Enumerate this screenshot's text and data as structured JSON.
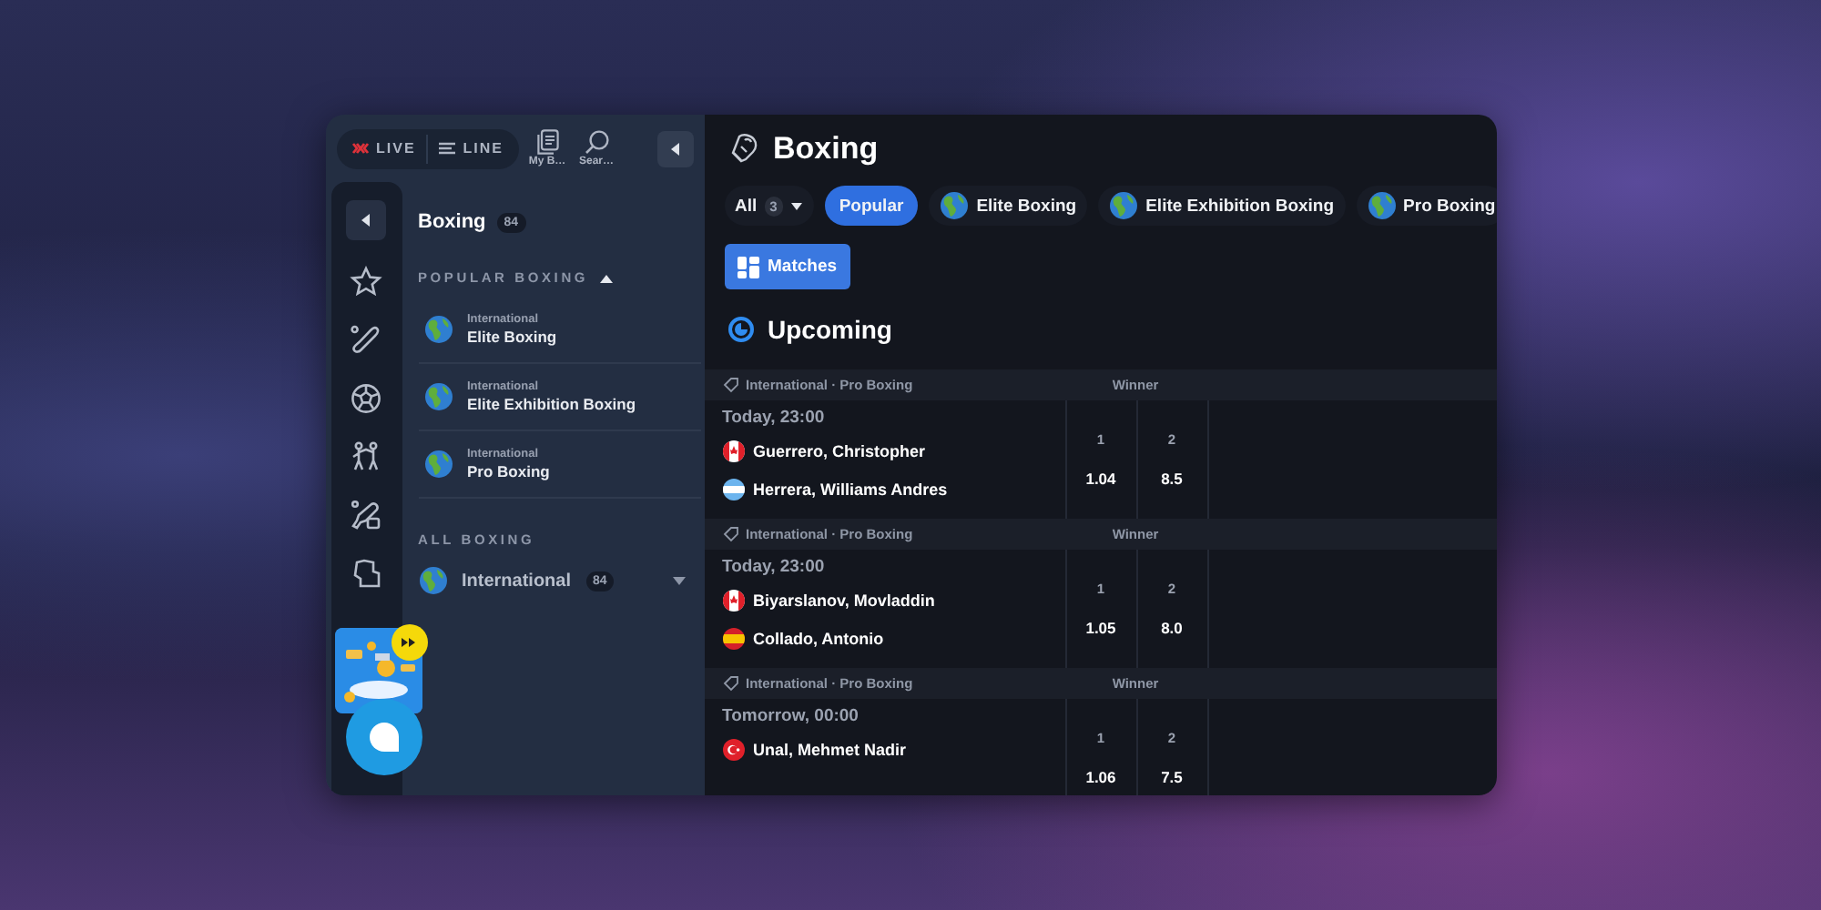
{
  "top_bar": {
    "modes": [
      {
        "label": "LIVE",
        "kind": "live",
        "selected": false
      },
      {
        "label": "LINE",
        "kind": "line",
        "selected": false
      }
    ],
    "actions": [
      {
        "label": "My B…",
        "kind": "bets"
      },
      {
        "label": "Sear…",
        "kind": "search"
      }
    ]
  },
  "sidebar": {
    "title": "Boxing",
    "count": "84",
    "popular": {
      "heading": "POPULAR BOXING",
      "expanded": true,
      "items": [
        {
          "category": "International",
          "name": "Elite Boxing"
        },
        {
          "category": "International",
          "name": "Elite Exhibition Boxing"
        },
        {
          "category": "International",
          "name": "Pro Boxing"
        }
      ]
    },
    "all": {
      "heading": "ALL BOXING",
      "items": [
        {
          "name": "International",
          "count": "84",
          "expanded": false
        }
      ]
    }
  },
  "main": {
    "title": "Boxing",
    "filters": [
      {
        "label": "All",
        "count": "3",
        "kind": "dropdown",
        "selected": false
      },
      {
        "label": "Popular",
        "kind": "plain",
        "selected": true
      },
      {
        "label": "Elite Boxing",
        "kind": "globe",
        "selected": false
      },
      {
        "label": "Elite Exhibition Boxing",
        "kind": "globe",
        "selected": false
      },
      {
        "label": "Pro Boxing",
        "kind": "globe",
        "selected": false
      }
    ],
    "views": [
      {
        "label": "Matches",
        "selected": true
      }
    ],
    "section_title": "Upcoming",
    "matches": [
      {
        "league": "International · Pro Boxing",
        "market": "Winner",
        "time": "Today, 23:00",
        "competitors": [
          {
            "name": "Guerrero, Christopher",
            "kind": "canada"
          },
          {
            "name": "Herrera, Williams Andres",
            "kind": "argentina"
          }
        ],
        "outcomes": [
          {
            "label": "1",
            "odds": "1.04"
          },
          {
            "label": "2",
            "odds": "8.5"
          }
        ]
      },
      {
        "league": "International · Pro Boxing",
        "market": "Winner",
        "time": "Today, 23:00",
        "competitors": [
          {
            "name": "Biyarslanov, Movladdin",
            "kind": "canada"
          },
          {
            "name": "Collado, Antonio",
            "kind": "spain"
          }
        ],
        "outcomes": [
          {
            "label": "1",
            "odds": "1.05"
          },
          {
            "label": "2",
            "odds": "8.0"
          }
        ]
      },
      {
        "league": "International · Pro Boxing",
        "market": "Winner",
        "time": "Tomorrow, 00:00",
        "competitors": [
          {
            "name": "Unal, Mehmet Nadir",
            "kind": "turkey"
          }
        ],
        "outcomes": [
          {
            "label": "1",
            "odds": "1.06"
          },
          {
            "label": "2",
            "odds": "7.5"
          }
        ]
      }
    ]
  }
}
